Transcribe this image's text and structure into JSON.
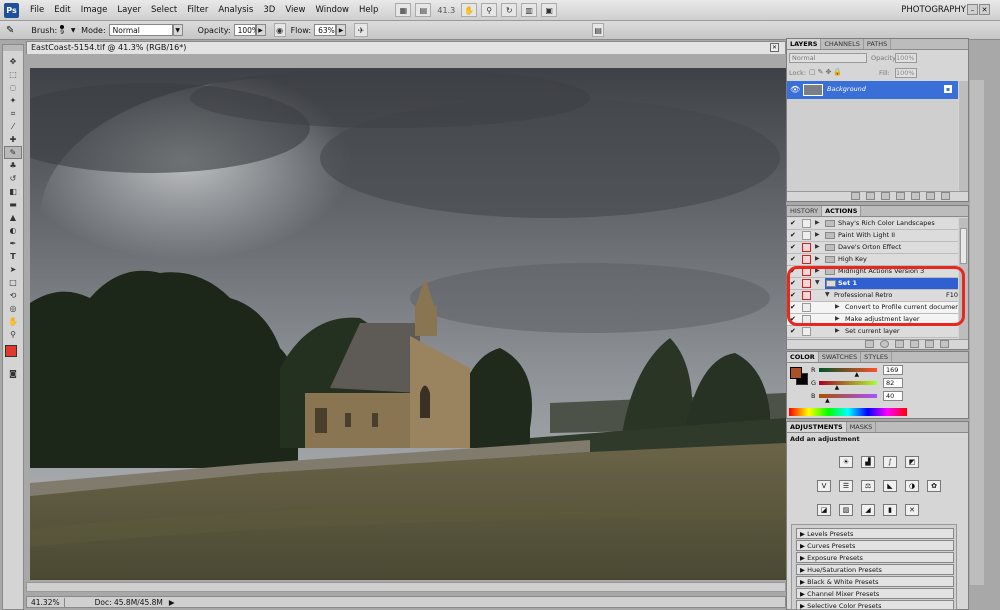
{
  "app": {
    "logo": "Ps",
    "workspace": "PHOTOGRAPHY",
    "zoom_readout": "41.3"
  },
  "menu": [
    "File",
    "Edit",
    "Image",
    "Layer",
    "Select",
    "Filter",
    "Analysis",
    "3D",
    "View",
    "Window",
    "Help"
  ],
  "options": {
    "brush_label": "Brush:",
    "brush_size": "9",
    "mode_label": "Mode:",
    "mode_value": "Normal",
    "opacity_label": "Opacity:",
    "opacity_value": "100%",
    "flow_label": "Flow:",
    "flow_value": "63%"
  },
  "document": {
    "tab_title": "EastCoast-5154.tif @ 41.3% (RGB/16*)",
    "status_zoom": "41.32%",
    "status_doc": "Doc: 45.8M/45.8M"
  },
  "layers_panel": {
    "tabs": [
      "LAYERS",
      "CHANNELS",
      "PATHS"
    ],
    "blend_mode": "Normal",
    "opacity_label": "Opacity:",
    "opacity_value": "100%",
    "lock_label": "Lock:",
    "fill_label": "Fill:",
    "fill_value": "100%",
    "layer_name": "Background"
  },
  "actions_panel": {
    "tabs": [
      "HISTORY",
      "ACTIONS"
    ],
    "items": [
      {
        "label": "Shay's Rich Color Landscapes"
      },
      {
        "label": "Paint With Light II"
      },
      {
        "label": "Dave's Orton Effect"
      },
      {
        "label": "High Key"
      },
      {
        "label": "Midnight Actions Version 3"
      },
      {
        "label": "Set 1"
      },
      {
        "label": "Professional Retro",
        "shortcut": "F10"
      },
      {
        "label": "Convert to Profile current document"
      },
      {
        "label": "Make adjustment layer"
      },
      {
        "label": "Set current layer"
      }
    ]
  },
  "color_panel": {
    "tabs": [
      "COLOR",
      "SWATCHES",
      "STYLES"
    ],
    "r_label": "R",
    "g_label": "G",
    "b_label": "B",
    "r_value": "169",
    "g_value": "82",
    "b_value": "40",
    "r": 169,
    "g": 82,
    "b": 40,
    "foreground_color": "#a95228"
  },
  "adjustments_panel": {
    "tabs": [
      "ADJUSTMENTS",
      "MASKS"
    ],
    "heading": "Add an adjustment",
    "presets": [
      "Levels Presets",
      "Curves Presets",
      "Exposure Presets",
      "Hue/Saturation Presets",
      "Black & White Presets",
      "Channel Mixer Presets",
      "Selective Color Presets"
    ]
  }
}
